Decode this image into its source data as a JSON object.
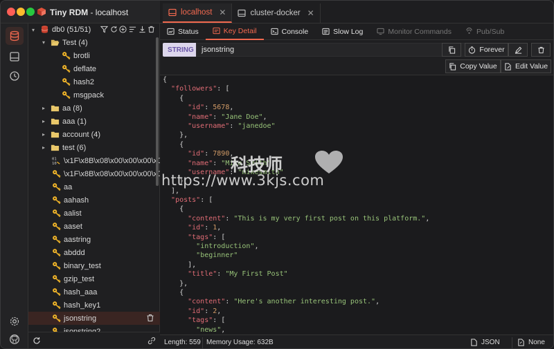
{
  "app": {
    "name": "Tiny RDM",
    "connection": "localhost",
    "title_sep": " - "
  },
  "tabs": [
    {
      "label": "localhost",
      "active": true
    },
    {
      "label": "cluster-docker",
      "active": false
    }
  ],
  "subtabs": [
    {
      "label": "Status",
      "icon": "status-icon"
    },
    {
      "label": "Key Detail",
      "icon": "key-detail-icon",
      "active": true
    },
    {
      "label": "Console",
      "icon": "console-icon"
    },
    {
      "label": "Slow Log",
      "icon": "slow-log-icon"
    },
    {
      "label": "Monitor Commands",
      "icon": "monitor-icon",
      "disabled": true
    },
    {
      "label": "Pub/Sub",
      "icon": "pubsub-icon",
      "disabled": true
    }
  ],
  "sidebar": {
    "db_label": "db0 (51/51)",
    "tree": [
      {
        "label": "Test (4)",
        "type": "folder-open",
        "depth": 1,
        "caret": "▾"
      },
      {
        "label": "brotli",
        "type": "key",
        "depth": 2
      },
      {
        "label": "deflate",
        "type": "key",
        "depth": 2
      },
      {
        "label": "hash2",
        "type": "key",
        "depth": 2
      },
      {
        "label": "msgpack",
        "type": "key",
        "depth": 2
      },
      {
        "label": "aa (8)",
        "type": "folder",
        "depth": 1,
        "caret": "▸"
      },
      {
        "label": "aaa (1)",
        "type": "folder",
        "depth": 1,
        "caret": "▸"
      },
      {
        "label": "account (4)",
        "type": "folder",
        "depth": 1,
        "caret": "▸"
      },
      {
        "label": "test (6)",
        "type": "folder",
        "depth": 1,
        "caret": "▸"
      },
      {
        "label": "\\x1F\\x8B\\x08\\x00\\x00\\x00\\x00...",
        "type": "binary",
        "depth": 1
      },
      {
        "label": "\\x1F\\x8B\\x08\\x00\\x00\\x00\\x00...",
        "type": "key",
        "depth": 1
      },
      {
        "label": "aa",
        "type": "key",
        "depth": 1
      },
      {
        "label": "aahash",
        "type": "key",
        "depth": 1
      },
      {
        "label": "aalist",
        "type": "key",
        "depth": 1
      },
      {
        "label": "aaset",
        "type": "key",
        "depth": 1
      },
      {
        "label": "aastring",
        "type": "key",
        "depth": 1
      },
      {
        "label": "abddd",
        "type": "key",
        "depth": 1
      },
      {
        "label": "binary_test",
        "type": "key",
        "depth": 1
      },
      {
        "label": "gzip_test",
        "type": "key",
        "depth": 1
      },
      {
        "label": "hash_aaa",
        "type": "key",
        "depth": 1
      },
      {
        "label": "hash_key1",
        "type": "key",
        "depth": 1
      },
      {
        "label": "jsonstring",
        "type": "key",
        "depth": 1,
        "selected": true
      },
      {
        "label": "jsonstring2",
        "type": "key",
        "depth": 1
      }
    ]
  },
  "key_detail": {
    "type": "STRING",
    "key_name": "jsonstring",
    "ttl_label": "Forever",
    "copy_label": "Copy Value",
    "edit_label": "Edit Value"
  },
  "editor_lines": [
    "{",
    "  \"followers\": [",
    "    {",
    "      \"id\": 5678,",
    "      \"name\": \"Jane Doe\",",
    "      \"username\": \"janedoe\"",
    "    },",
    "    {",
    "      \"id\": 7890,",
    "      \"name\": \"Mike Smith\",",
    "      \"username\": \"mikesmith\"",
    "    }",
    "  ],",
    "  \"posts\": [",
    "    {",
    "      \"content\": \"This is my very first post on this platform.\",",
    "      \"id\": 1,",
    "      \"tags\": [",
    "        \"introduction\",",
    "        \"beginner\"",
    "      ],",
    "      \"title\": \"My First Post\"",
    "    },",
    "    {",
    "      \"content\": \"Here's another interesting post.\",",
    "      \"id\": 2,",
    "      \"tags\": [",
    "        \"news\","
  ],
  "status": {
    "length": "Length: 559",
    "memory": "Memory Usage: 632B",
    "format": "JSON",
    "decode": "None"
  },
  "watermark": {
    "cn": "科技师",
    "url": "https://www.3kjs.com"
  },
  "colors": {
    "accent": "#f2694f",
    "key_icon": "#f0b429",
    "folder": "#e8c76a"
  }
}
